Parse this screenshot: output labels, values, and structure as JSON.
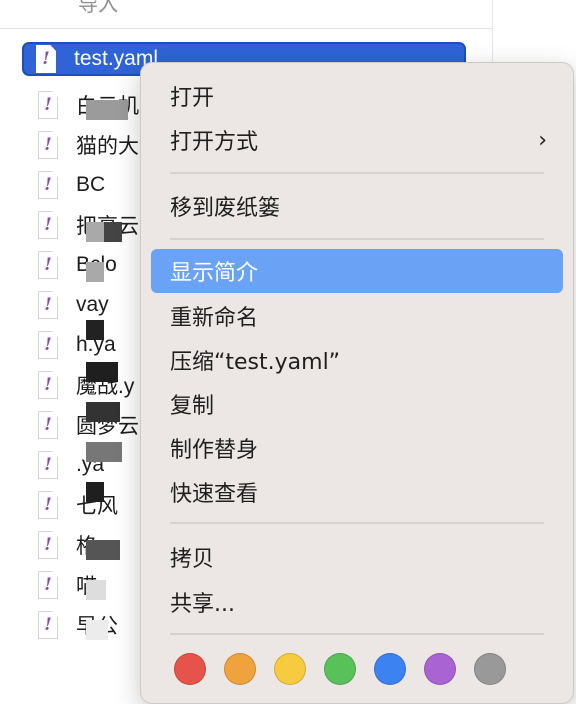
{
  "finder": {
    "top_partial_label": "导入",
    "selected_file": "test.yaml",
    "rows": [
      {
        "name": "白云机"
      },
      {
        "name": "猫的大"
      },
      {
        "name": "BC"
      },
      {
        "name": "把亮云"
      },
      {
        "name": "Bclo"
      },
      {
        "name": "vay"
      },
      {
        "name": "h.ya"
      },
      {
        "name": "魔战.y"
      },
      {
        "name": "圆梦云"
      },
      {
        "name": ".ya"
      },
      {
        "name": "七风"
      },
      {
        "name": "格"
      },
      {
        "name": "喵"
      },
      {
        "name": "早公"
      }
    ]
  },
  "context_menu": {
    "items": [
      {
        "label": "打开"
      },
      {
        "label": "打开方式",
        "has_submenu": true,
        "chevron": "›"
      },
      {
        "label": "移到废纸篓"
      },
      {
        "label": "显示简介",
        "highlighted": true
      },
      {
        "label": "重新命名"
      },
      {
        "label": "压缩“test.yaml”"
      },
      {
        "label": "复制"
      },
      {
        "label": "制作替身"
      },
      {
        "label": "快速查看"
      },
      {
        "label": "拷贝"
      },
      {
        "label": "共享..."
      }
    ],
    "tag_colors": [
      "#e5534b",
      "#f0a33c",
      "#f6cb3f",
      "#59c15a",
      "#3d82f1",
      "#a963d3",
      "#999999"
    ]
  }
}
